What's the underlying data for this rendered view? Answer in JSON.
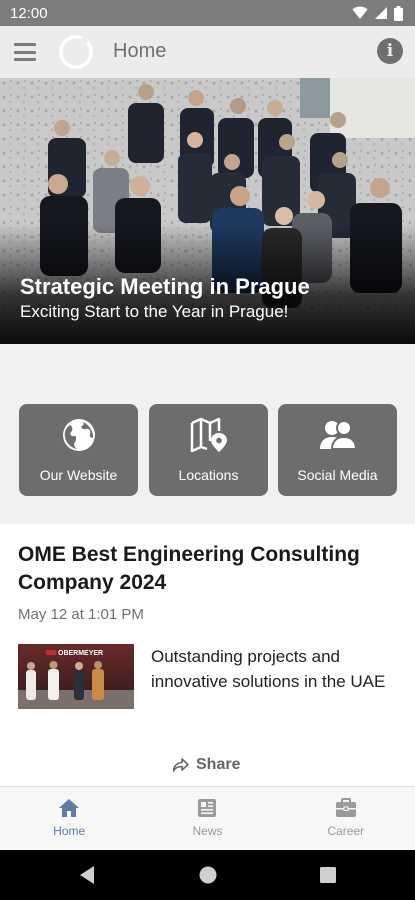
{
  "status_bar": {
    "time": "12:00"
  },
  "app_bar": {
    "title": "Home"
  },
  "hero": {
    "title": "Strategic Meeting in Prague",
    "subtitle": "Exciting Start to the Year in Prague!"
  },
  "tiles": [
    {
      "label": "Our Website",
      "icon": "globe-icon"
    },
    {
      "label": "Locations",
      "icon": "map-pin-icon"
    },
    {
      "label": "Social Media",
      "icon": "people-icon"
    }
  ],
  "news": {
    "title": "OME Best Engineering Consulting Company 2024",
    "date": "May 12 at 1:01 PM",
    "excerpt": "Outstanding projects and innovative solutions in the UAE",
    "thumbnail_brand_text": "OBERMEYER",
    "share_label": "Share"
  },
  "bottom_nav": [
    {
      "label": "Home",
      "icon": "home-icon",
      "active": true
    },
    {
      "label": "News",
      "icon": "news-icon",
      "active": false
    },
    {
      "label": "Career",
      "icon": "briefcase-icon",
      "active": false
    }
  ],
  "colors": {
    "status_bar": "#7c7c7c",
    "app_bar": "#ececec",
    "tile": "#6d6d6d",
    "active_nav": "#5b7ea3",
    "inactive_nav": "#9a9a9a"
  }
}
